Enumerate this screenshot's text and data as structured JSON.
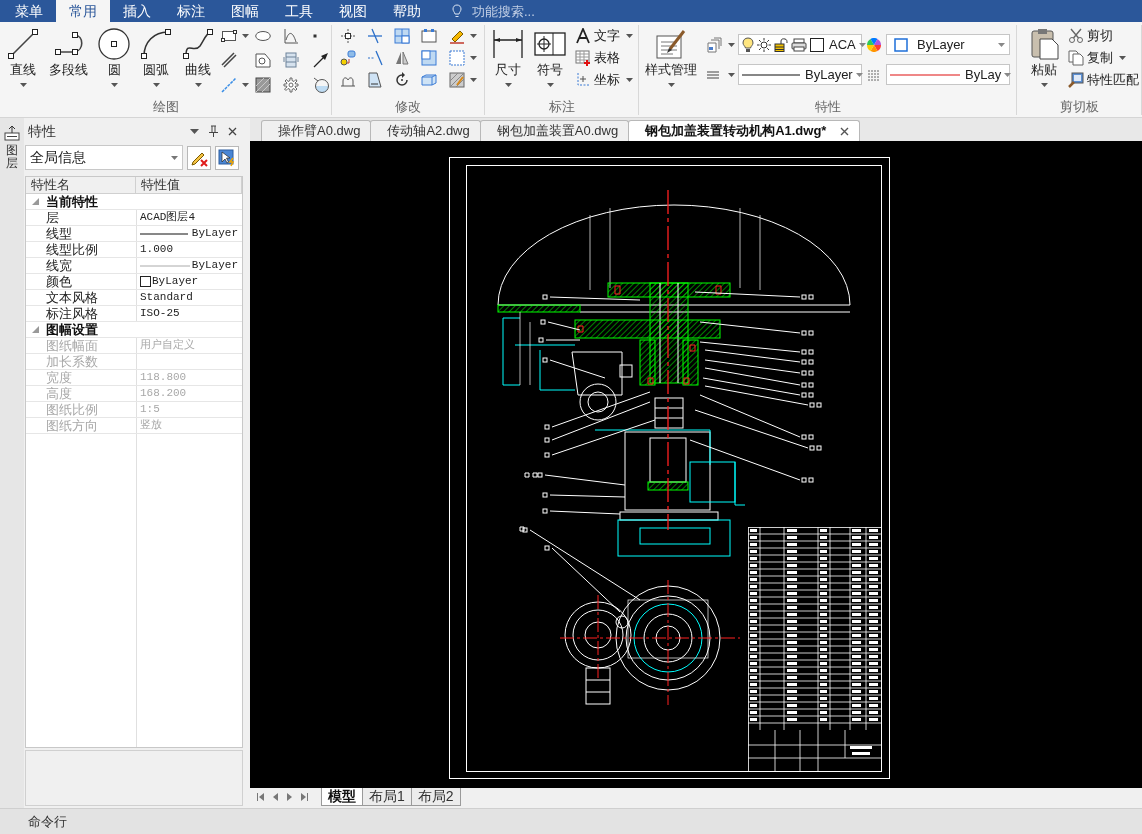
{
  "menu_bar": {
    "tabs": [
      {
        "label": "菜单",
        "selected": false
      },
      {
        "label": "常用",
        "selected": true
      },
      {
        "label": "插入",
        "selected": false
      },
      {
        "label": "标注",
        "selected": false
      },
      {
        "label": "图幅",
        "selected": false
      },
      {
        "label": "工具",
        "selected": false
      },
      {
        "label": "视图",
        "selected": false
      },
      {
        "label": "帮助",
        "selected": false
      }
    ],
    "search": {
      "placeholder": "功能搜索..."
    }
  },
  "ribbon": {
    "groups": [
      {
        "kind": "draw",
        "title": "绘图",
        "large_buttons": [
          {
            "label": "直线",
            "dropdown": true
          },
          {
            "label": "多段线",
            "dropdown": false
          },
          {
            "label": "圆",
            "dropdown": true
          },
          {
            "label": "圆弧",
            "dropdown": true
          },
          {
            "label": "曲线",
            "dropdown": true
          }
        ]
      },
      {
        "kind": "modify",
        "title": "修改"
      },
      {
        "kind": "annotate",
        "title": "标注",
        "large_buttons": [
          {
            "label": "尺寸",
            "dropdown": true
          },
          {
            "label": "符号",
            "dropdown": true
          }
        ],
        "small_buttons": [
          {
            "label": "文字",
            "dropdown": true
          },
          {
            "label": "表格",
            "dropdown": false
          },
          {
            "label": "坐标",
            "dropdown": true
          }
        ]
      },
      {
        "kind": "properties",
        "title": "特性",
        "large_buttons": [
          {
            "label": "样式管理",
            "dropdown": true
          }
        ],
        "fields": [
          {
            "kind": "layer",
            "value": "ACA"
          },
          {
            "kind": "color",
            "value": "ByLayer"
          },
          {
            "kind": "linetype",
            "value": "ByLayer"
          },
          {
            "kind": "lineweight",
            "value": "ByLay"
          }
        ]
      },
      {
        "kind": "clipboard",
        "title": "剪切板",
        "large_buttons": [
          {
            "label": "粘贴",
            "dropdown": true
          }
        ],
        "small_buttons": [
          {
            "label": "剪切",
            "dropdown": false
          },
          {
            "label": "复制",
            "dropdown": true
          },
          {
            "label": "特性匹配",
            "dropdown": false
          }
        ]
      }
    ]
  },
  "side_tab": {
    "label": "图层"
  },
  "properties_panel": {
    "title": "特性",
    "selector": {
      "value": "全局信息"
    },
    "columns": [
      "特性名",
      "特性值"
    ],
    "sections": [
      {
        "title": "当前特性",
        "expanded": true,
        "rows": [
          {
            "kind": "text",
            "name": "层",
            "value": "ACAD图层4",
            "disabled": false
          },
          {
            "kind": "line",
            "name": "线型",
            "value": "ByLayer",
            "disabled": false
          },
          {
            "kind": "text",
            "name": "线型比例",
            "value": "1.000",
            "disabled": false
          },
          {
            "kind": "thin_line",
            "name": "线宽",
            "value": "ByLayer",
            "disabled": false
          },
          {
            "kind": "swatch",
            "name": "颜色",
            "value": "ByLayer",
            "disabled": false
          },
          {
            "kind": "text",
            "name": "文本风格",
            "value": "Standard",
            "disabled": false
          },
          {
            "kind": "text",
            "name": "标注风格",
            "value": "ISO-25",
            "disabled": false
          }
        ]
      },
      {
        "title": "图幅设置",
        "expanded": true,
        "rows": [
          {
            "kind": "text",
            "name": "图纸幅面",
            "value": "用户自定义",
            "disabled": true
          },
          {
            "kind": "text",
            "name": "加长系数",
            "disabled": true
          },
          {
            "kind": "text",
            "name": "宽度",
            "value": "118.800",
            "disabled": true
          },
          {
            "kind": "text",
            "name": "高度",
            "value": "168.200",
            "disabled": true
          },
          {
            "kind": "text",
            "name": "图纸比例",
            "value": "1:5",
            "disabled": true
          },
          {
            "kind": "text",
            "name": "图纸方向",
            "value": "竖放",
            "disabled": true
          }
        ]
      }
    ]
  },
  "document_tabs": [
    {
      "label": "操作臂A0.dwg",
      "selected": false
    },
    {
      "label": "传动轴A2.dwg",
      "selected": false
    },
    {
      "label": "钢包加盖装置A0.dwg",
      "selected": false
    },
    {
      "label": "钢包加盖装置转动机构A1.dwg*",
      "selected": true
    }
  ],
  "layout_tabs": [
    {
      "label": "模型",
      "selected": true
    },
    {
      "label": "布局1",
      "selected": false
    },
    {
      "label": "布局2",
      "selected": false
    }
  ],
  "command_line": {
    "label": "命令行"
  }
}
